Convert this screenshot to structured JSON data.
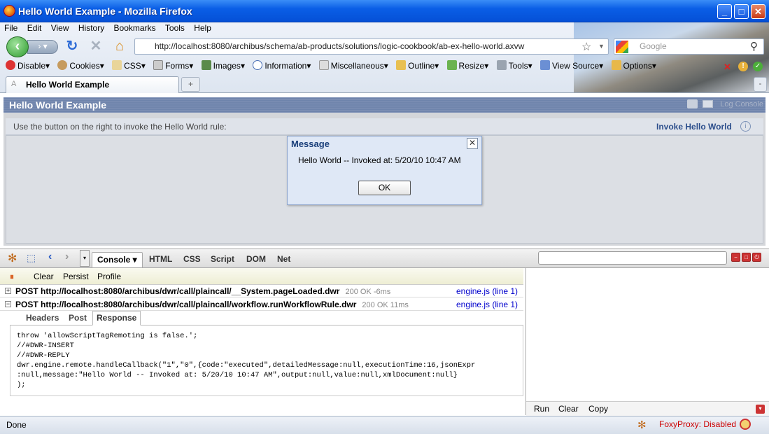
{
  "window": {
    "title": "Hello World Example - Mozilla Firefox"
  },
  "menu": [
    "File",
    "Edit",
    "View",
    "History",
    "Bookmarks",
    "Tools",
    "Help"
  ],
  "nav": {
    "url": "http://localhost:8080/archibus/schema/ab-products/solutions/logic-cookbook/ab-ex-hello-world.axvw",
    "search_placeholder": "Google"
  },
  "webdev_toolbar": [
    "Disable",
    "Cookies",
    "CSS",
    "Forms",
    "Images",
    "Information",
    "Miscellaneous",
    "Outline",
    "Resize",
    "Tools",
    "View Source",
    "Options"
  ],
  "tab": {
    "label": "Hello World Example",
    "new_tab": "+"
  },
  "page": {
    "panel_title": "Hello World Example",
    "log_console": "Log Console",
    "instruction": "Use the button on the right to invoke the Hello World rule:",
    "invoke_button": "Invoke Hello World",
    "info_glyph": "i"
  },
  "dialog": {
    "title": "Message",
    "message": "Hello World -- Invoked at: 5/20/10 10:47 AM",
    "ok": "OK",
    "close": "✕"
  },
  "firebug": {
    "tabs": [
      "Console",
      "HTML",
      "CSS",
      "Script",
      "DOM",
      "Net"
    ],
    "console_toolbar": [
      "Clear",
      "Persist",
      "Profile"
    ],
    "requests": [
      {
        "toggle": "+",
        "url": "POST http://localhost:8080/archibus/dwr/call/plaincall/__System.pageLoaded.dwr",
        "status": "200 OK -6ms",
        "source": "engine.js (line 1)"
      },
      {
        "toggle": "−",
        "url": "POST http://localhost:8080/archibus/dwr/call/plaincall/workflow.runWorkflowRule.dwr",
        "status": "200 OK 11ms",
        "source": "engine.js (line 1)"
      }
    ],
    "response_tabs": [
      "Headers",
      "Post",
      "Response"
    ],
    "response_text": "throw 'allowScriptTagRemoting is false.';\n//#DWR-INSERT\n//#DWR-REPLY\ndwr.engine.remote.handleCallback(\"1\",\"0\",{code:\"executed\",detailedMessage:null,executionTime:16,jsonExpr\n:null,message:\"Hello World -- Invoked at: 5/20/10 10:47 AM\",output:null,value:null,xmlDocument:null}\n);",
    "side_buttons": [
      "Run",
      "Clear",
      "Copy"
    ]
  },
  "status": {
    "text": "Done",
    "foxyproxy": "FoxyProxy: Disabled"
  }
}
